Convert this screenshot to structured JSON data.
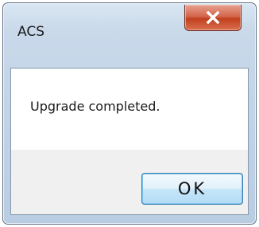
{
  "dialog": {
    "title": "ACS",
    "message": "Upgrade completed.",
    "ok_label": "OK",
    "close_icon": "close-icon"
  },
  "colors": {
    "close_button": "#c7502f",
    "ok_button_border": "#3c7fb1",
    "frame": "#c9d9ea"
  }
}
